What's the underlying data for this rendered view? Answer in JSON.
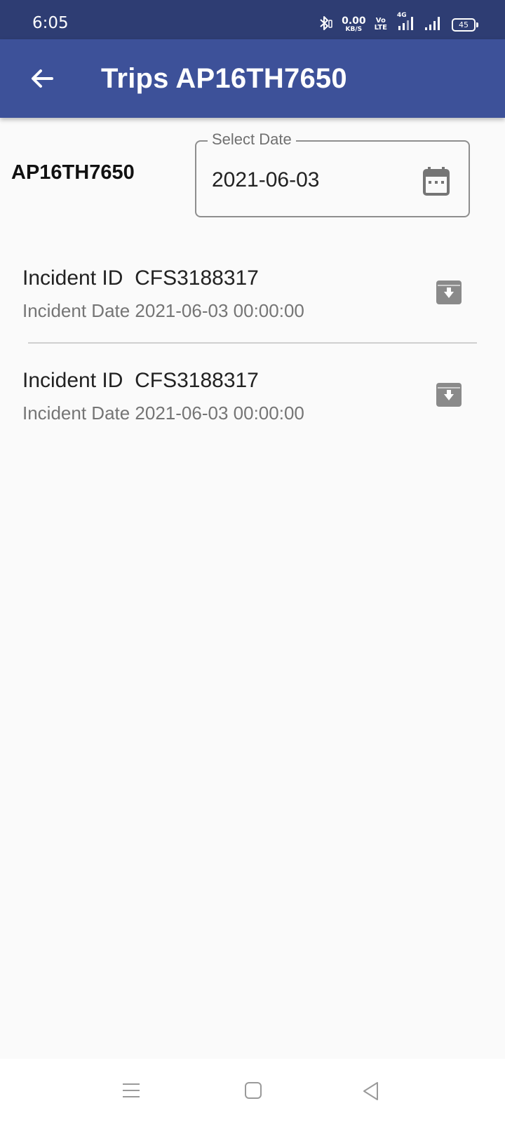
{
  "status_bar": {
    "time": "6:05",
    "speed_value": "0.00",
    "speed_unit": "KB/S",
    "volte_top": "Vo",
    "volte_bottom": "LTE",
    "network_type": "4G",
    "battery": "45"
  },
  "app_bar": {
    "title": "Trips AP16TH7650",
    "back_icon": "arrow-left-icon"
  },
  "vehicle": {
    "label": "AP16TH7650"
  },
  "date_field": {
    "label": "Select Date",
    "value": "2021-06-03",
    "icon": "calendar-icon"
  },
  "incidents": [
    {
      "title": "Incident ID  CFS3188317",
      "subtitle": "Incident Date 2021-06-03 00:00:00",
      "action_icon": "archive-download-icon"
    },
    {
      "title": "Incident ID  CFS3188317",
      "subtitle": "Incident Date 2021-06-03 00:00:00",
      "action_icon": "archive-download-icon"
    }
  ],
  "colors": {
    "status_bar": "#2e3d73",
    "app_bar": "#3d5199",
    "background": "#fafafa",
    "icon_gray": "#8a8a8a"
  },
  "nav_bar": {
    "icons": [
      "menu-icon",
      "home-square-icon",
      "back-triangle-icon"
    ]
  }
}
